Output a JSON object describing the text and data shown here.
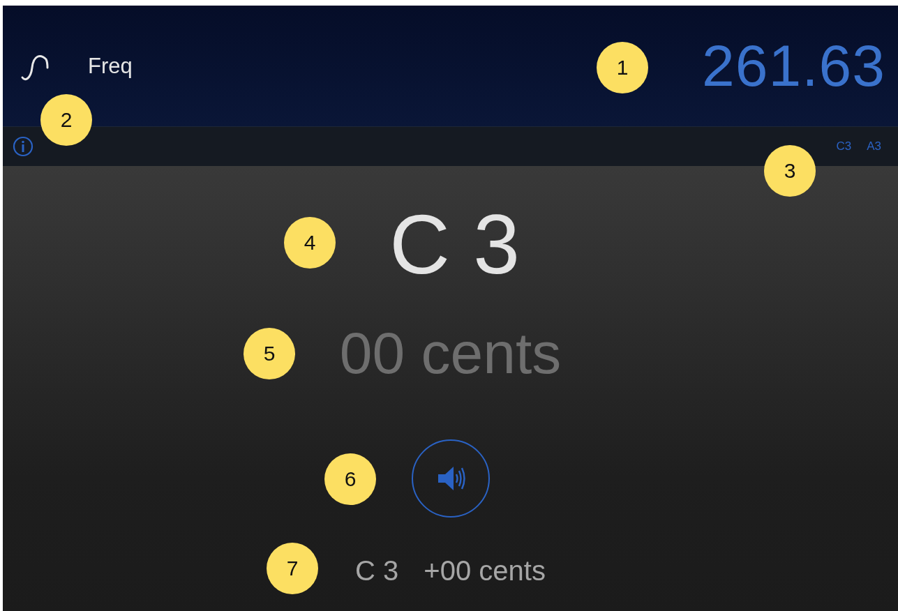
{
  "header": {
    "title": "Freq",
    "frequency": "261.63"
  },
  "toolbar": {
    "note_buttons": [
      "C3",
      "A3"
    ]
  },
  "note": "C 3",
  "cents": "00 cents",
  "reference": {
    "note": "C 3",
    "cents": "+00 cents"
  },
  "callouts": [
    "1",
    "2",
    "3",
    "4",
    "5",
    "6",
    "7"
  ]
}
